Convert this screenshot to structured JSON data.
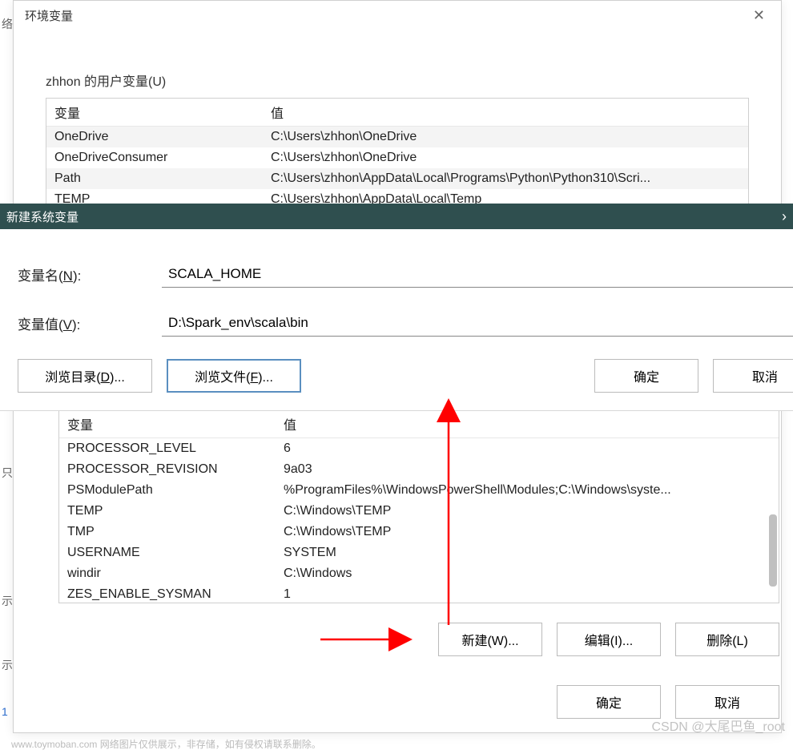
{
  "bg_dialog": {
    "title": "环境变量",
    "user_section_label": "zhhon 的用户变量(U)",
    "headers": {
      "var": "变量",
      "val": "值"
    },
    "user_rows": [
      {
        "name": "OneDrive",
        "value": "C:\\Users\\zhhon\\OneDrive"
      },
      {
        "name": "OneDriveConsumer",
        "value": "C:\\Users\\zhhon\\OneDrive"
      },
      {
        "name": "Path",
        "value": "C:\\Users\\zhhon\\AppData\\Local\\Programs\\Python\\Python310\\Scri..."
      },
      {
        "name": "TEMP",
        "value": "C:\\Users\\zhhon\\AppData\\Local\\Temp"
      }
    ],
    "sys_rows": [
      {
        "name": "PROCESSOR_LEVEL",
        "value": "6"
      },
      {
        "name": "PROCESSOR_REVISION",
        "value": "9a03"
      },
      {
        "name": "PSModulePath",
        "value": "%ProgramFiles%\\WindowsPowerShell\\Modules;C:\\Windows\\syste..."
      },
      {
        "name": "TEMP",
        "value": "C:\\Windows\\TEMP"
      },
      {
        "name": "TMP",
        "value": "C:\\Windows\\TEMP"
      },
      {
        "name": "USERNAME",
        "value": "SYSTEM"
      },
      {
        "name": "windir",
        "value": "C:\\Windows"
      },
      {
        "name": "ZES_ENABLE_SYSMAN",
        "value": "1"
      }
    ],
    "sys_buttons": {
      "new": "新建(W)...",
      "edit": "编辑(I)...",
      "delete": "删除(L)"
    },
    "footer": {
      "ok": "确定",
      "cancel": "取消"
    }
  },
  "modal": {
    "title": "新建系统变量",
    "name_label_pre": "变量名(",
    "name_label_u": "N",
    "name_label_post": "):",
    "value_label_pre": "变量值(",
    "value_label_u": "V",
    "value_label_post": "):",
    "name_value": "SCALA_HOME",
    "value_value": "D:\\Spark_env\\scala\\bin",
    "browse_dir_pre": "浏览目录(",
    "browse_dir_u": "D",
    "browse_dir_post": ")...",
    "browse_file_pre": "浏览文件(",
    "browse_file_u": "F",
    "browse_file_post": ")...",
    "ok": "确定",
    "cancel": "取消"
  },
  "watermark": "CSDN @大尾巴鱼_root",
  "footnote": "www.toymoban.com 网络图片仅供展示，非存储，如有侵权请联系删除。",
  "left_fragments": {
    "a": "络",
    "b": "只",
    "c": "示",
    "d": "示",
    "e": "1"
  }
}
